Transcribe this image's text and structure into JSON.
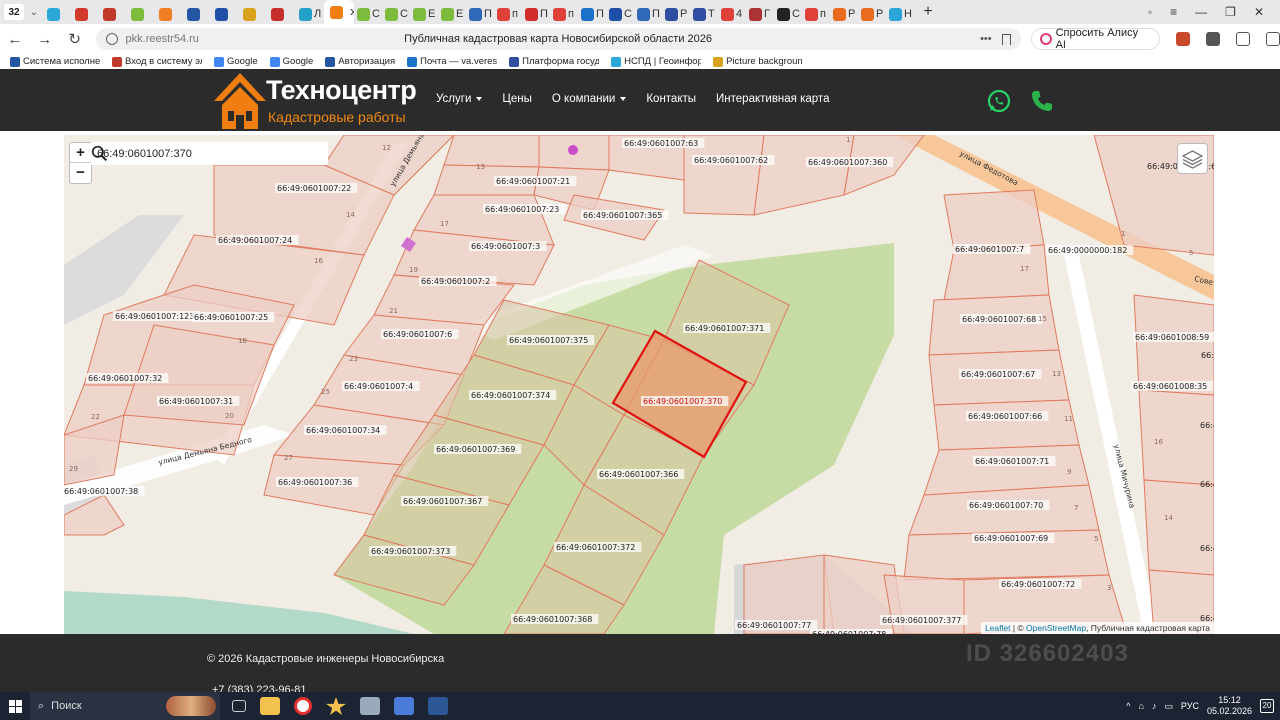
{
  "browser": {
    "tab_count": "32",
    "tabs": [
      {
        "label": "",
        "color": "#2aa7d6"
      },
      {
        "label": "",
        "color": "#d33a2c"
      },
      {
        "label": "",
        "color": "#c0392b"
      },
      {
        "label": "",
        "color": "#7dbb3c"
      },
      {
        "label": "",
        "color": "#f07d22"
      },
      {
        "label": "",
        "color": "#2456a4"
      },
      {
        "label": "",
        "color": "#1f4fa6"
      },
      {
        "label": "",
        "color": "#d8a31a"
      },
      {
        "label": "",
        "color": "#c62d2d"
      },
      {
        "label": "Л",
        "color": "#23a0c8"
      },
      {
        "label": "С",
        "color": "#7dbb3c"
      },
      {
        "label": "С",
        "color": "#7dbb3c"
      },
      {
        "label": "Е",
        "color": "#7dbb3c"
      },
      {
        "label": "Е",
        "color": "#7dbb3c"
      },
      {
        "label": "П",
        "color": "#3068b8"
      },
      {
        "label": "п",
        "color": "#e0403a"
      },
      {
        "label": "П",
        "color": "#d22c2c"
      },
      {
        "label": "п",
        "color": "#e0403a"
      },
      {
        "label": "П",
        "color": "#1a73c8"
      },
      {
        "label": "С",
        "color": "#1f4fa6"
      },
      {
        "label": "П",
        "color": "#3068b8"
      },
      {
        "label": "Р",
        "color": "#2f4ea1"
      },
      {
        "label": "Т",
        "color": "#2f4ea1"
      },
      {
        "label": "4",
        "color": "#e0403a"
      },
      {
        "label": "Г",
        "color": "#a33"
      },
      {
        "label": "С",
        "color": "#222"
      },
      {
        "label": "п",
        "color": "#e0403a"
      },
      {
        "label": "Р",
        "color": "#e86b1f"
      },
      {
        "label": "Р",
        "color": "#e86b1f"
      },
      {
        "label": "Н",
        "color": "#2aa7d6"
      }
    ],
    "active_tab_label": "",
    "url_domain": "pkk.reestr54.ru",
    "page_title": "Публичная кадастровая карта Новосибирской области 2026",
    "alice_button": "Спросить Алису AI",
    "bookmarks": [
      {
        "label": "Система исполне",
        "color": "#2456a4"
      },
      {
        "label": "Вход в систему эл",
        "color": "#c0392b"
      },
      {
        "label": "Google",
        "color": "#4285f4"
      },
      {
        "label": "Google",
        "color": "#4285f4"
      },
      {
        "label": "Авторизация",
        "color": "#2456a4"
      },
      {
        "label": "Почта — va.verest",
        "color": "#1a73c8"
      },
      {
        "label": "Платформа госуд",
        "color": "#2f4ea1"
      },
      {
        "label": "НСПД | Геоинфор",
        "color": "#2aa7d6"
      },
      {
        "label": "Picture backgroun",
        "color": "#d8a31a"
      }
    ]
  },
  "site": {
    "logo_title": "Техноцентр",
    "logo_subtitle": "Кадастровые работы",
    "menu": [
      {
        "label": "Услуги",
        "dropdown": true
      },
      {
        "label": "Цены",
        "dropdown": false
      },
      {
        "label": "О компании",
        "dropdown": true
      },
      {
        "label": "Контакты",
        "dropdown": false
      },
      {
        "label": "Интерактивная карта",
        "dropdown": false
      }
    ],
    "accent_color": "#f07d10",
    "contact_icons": [
      "whatsapp-icon",
      "phone-icon"
    ]
  },
  "map": {
    "search_value": "66:49:0601007:370",
    "zoom_in": "+",
    "zoom_out": "−",
    "selected_parcel": "66:49:0601007:370",
    "parcel_labels": [
      "66:49:0601007:63",
      "66:49:0601007:62",
      "66:49:0601007:360",
      "66:49:0601007:21",
      "66:49:0601007:22",
      "66:49:0601007:23",
      "66:49:0601007:365",
      "66:49:0601007:24",
      "66:49:0601007:3",
      "66:49:0601007:2",
      "66:49:0601007:123",
      "66:49:0601007:25",
      "66:49:0601007:6",
      "66:49:0601007:375",
      "66:49:0601007:371",
      "66:49:0601007:32",
      "66:49:0601007:4",
      "66:49:0601007:31",
      "66:49:0601007:374",
      "66:49:0601007:370",
      "66:49:0601007:34",
      "66:49:0601007:369",
      "66:49:0601007:36",
      "66:49:0601007:366",
      "66:49:0601007:38",
      "66:49:0601007:367",
      "66:49:0601007:373",
      "66:49:0601007:372",
      "66:49:0601007:368",
      "66:49:0601007:77",
      "66:49:0601007:78",
      "66:49:0601007:377",
      "66:49:0601007:7",
      "66:49:0000000:182",
      "66:49:0601007:68",
      "66:49:0601008:59",
      "66:49:0601007:67",
      "66:49:0601008:35",
      "66:49:0601007:66",
      "66:49:0601007:71",
      "66:49:0601007:70",
      "66:49:0601007:69",
      "66:49:0601007:72"
    ],
    "label_right_edge": [
      "66:49:0601007:62",
      "66:49:0601008:6",
      "66:49:060100",
      "66:49:060100",
      "66:49:060100",
      "66:49:0601"
    ],
    "building_numbers": [
      "13",
      "12",
      "14",
      "17",
      "16",
      "19",
      "18",
      "21",
      "23",
      "25",
      "20",
      "22",
      "27",
      "29",
      "17",
      "15",
      "13",
      "11",
      "9",
      "7",
      "5",
      "3",
      "16",
      "14",
      "1",
      "1",
      "5"
    ],
    "street_labels": [
      "улица Демьяна Бе",
      "улица Демьяна Бедного",
      "улица Федотова",
      "улица Мичурина",
      "Совет"
    ],
    "attribution": {
      "leaflet": "Leaflet",
      "osm": "OpenStreetMap",
      "rest": "Публичная кадастровая карта",
      "sep": " | © ",
      "comma": ", "
    }
  },
  "footer": {
    "copyright": "© 2026 Кадастровые инженеры Новосибирска",
    "phone": "+7 (383) 223-96-81",
    "watermark": "ID 326602403"
  },
  "taskbar": {
    "search_placeholder": "Поиск",
    "lang": "РУС",
    "time": "15:12",
    "date": "05.02.2026",
    "notifications": "20"
  }
}
